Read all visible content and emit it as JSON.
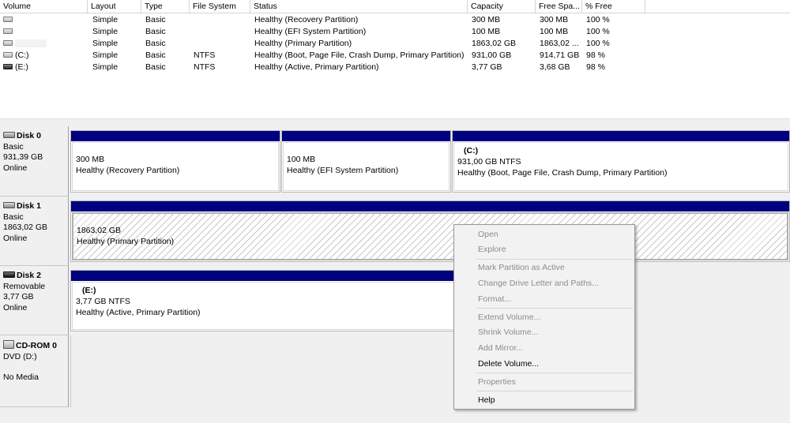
{
  "columns": [
    "Volume",
    "Layout",
    "Type",
    "File System",
    "Status",
    "Capacity",
    "Free Spa...",
    "% Free"
  ],
  "volumes": [
    {
      "name": "",
      "layout": "Simple",
      "type": "Basic",
      "fs": "",
      "status": "Healthy (Recovery Partition)",
      "capacity": "300 MB",
      "free": "300 MB",
      "pct": "100 %"
    },
    {
      "name": "",
      "layout": "Simple",
      "type": "Basic",
      "fs": "",
      "status": "Healthy (EFI System Partition)",
      "capacity": "100 MB",
      "free": "100 MB",
      "pct": "100 %"
    },
    {
      "name": "",
      "layout": "Simple",
      "type": "Basic",
      "fs": "",
      "status": "Healthy (Primary Partition)",
      "capacity": "1863,02 GB",
      "free": "1863,02 ...",
      "pct": "100 %"
    },
    {
      "name": "(C:)",
      "layout": "Simple",
      "type": "Basic",
      "fs": "NTFS",
      "status": "Healthy (Boot, Page File, Crash Dump, Primary Partition)",
      "capacity": "931,00 GB",
      "free": "914,71 GB",
      "pct": "98 %"
    },
    {
      "name": "(E:)",
      "layout": "Simple",
      "type": "Basic",
      "fs": "NTFS",
      "status": "Healthy (Active, Primary Partition)",
      "capacity": "3,77 GB",
      "free": "3,68 GB",
      "pct": "98 %"
    }
  ],
  "disks": [
    {
      "name": "Disk 0",
      "kind": "Basic",
      "size": "931,39 GB",
      "state": "Online",
      "partitions": [
        {
          "title": "",
          "line1": "300 MB",
          "line2": "Healthy (Recovery Partition)"
        },
        {
          "title": "",
          "line1": "100 MB",
          "line2": "Healthy (EFI System Partition)"
        },
        {
          "title": "(C:)",
          "line1": "931,00 GB NTFS",
          "line2": "Healthy (Boot, Page File, Crash Dump, Primary Partition)"
        }
      ]
    },
    {
      "name": "Disk 1",
      "kind": "Basic",
      "size": "1863,02 GB",
      "state": "Online",
      "partitions": [
        {
          "title": "",
          "line1": "1863,02 GB",
          "line2": "Healthy (Primary Partition)"
        }
      ]
    },
    {
      "name": "Disk 2",
      "kind": "Removable",
      "size": "3,77 GB",
      "state": "Online",
      "partitions": [
        {
          "title": "(E:)",
          "line1": "3,77 GB NTFS",
          "line2": "Healthy (Active, Primary Partition)"
        }
      ]
    },
    {
      "name": "CD-ROM 0",
      "kind": "DVD (D:)",
      "size": "",
      "state": "No Media",
      "partitions": []
    }
  ],
  "context_menu": {
    "items": [
      {
        "label": "Open",
        "enabled": false
      },
      {
        "label": "Explore",
        "enabled": false
      },
      {
        "label": "Mark Partition as Active",
        "enabled": false
      },
      {
        "label": "Change Drive Letter and Paths...",
        "enabled": false
      },
      {
        "label": "Format...",
        "enabled": false
      },
      {
        "label": "Extend Volume...",
        "enabled": false
      },
      {
        "label": "Shrink Volume...",
        "enabled": false
      },
      {
        "label": "Add Mirror...",
        "enabled": false
      },
      {
        "label": "Delete Volume...",
        "enabled": true
      },
      {
        "label": "Properties",
        "enabled": false
      },
      {
        "label": "Help",
        "enabled": true
      }
    ]
  },
  "colors": {
    "partition_bar": "#01007f",
    "background": "#f0f0f0",
    "menu_disabled": "#8c8c8c"
  }
}
